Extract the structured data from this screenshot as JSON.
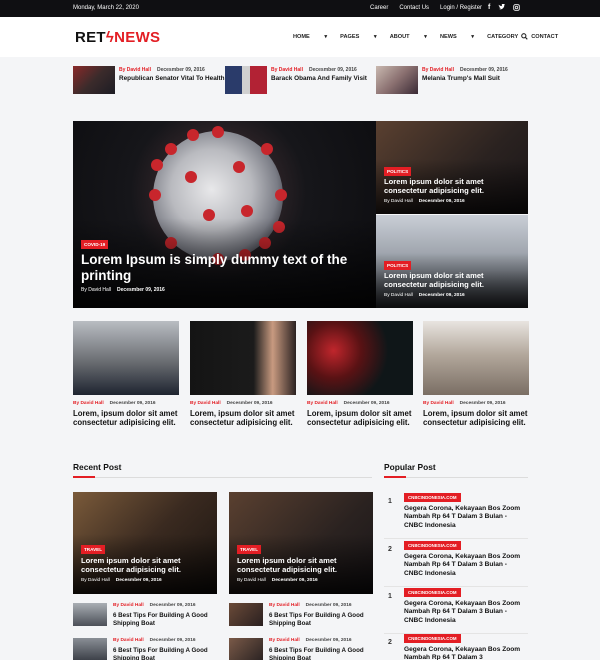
{
  "topbar": {
    "date": "Monday, March 22, 2020",
    "links": [
      "Career",
      "Contact Us",
      "Login / Register"
    ],
    "social_icons": [
      "facebook-icon",
      "twitter-icon",
      "instagram-icon"
    ]
  },
  "logo": {
    "part1": "RET",
    "part2": "NEWS"
  },
  "nav": {
    "items": [
      "HOME",
      "PAGES",
      "ABOUT",
      "NEWS",
      "CATEGORY",
      "CONTACT"
    ],
    "search_icon": "search-icon"
  },
  "ticker": [
    {
      "author": "By David Hall",
      "date": "Decesmber 09, 2016",
      "title": "Republican Senator Vital To Health"
    },
    {
      "author": "By David Hall",
      "date": "Decesmber 09, 2016",
      "title": "Barack Obama And Family Visit"
    },
    {
      "author": "By David Hall",
      "date": "Decesmber 09, 2016",
      "title": "Melania Trump's Mall Suit"
    }
  ],
  "hero": {
    "badge": "COVID-19",
    "title": "Lorem Ipsum is simply dummy text of the printing",
    "author": "By David Hall",
    "date": "Decesmber 09, 2016"
  },
  "side_stories": [
    {
      "badge": "POLITICS",
      "title": "Lorem ipsum dolor sit amet consectetur adipisicing elit.",
      "author": "By David Hall",
      "date": "Decesmber 09, 2016"
    },
    {
      "badge": "POLITICS",
      "title": "Lorem ipsum dolor sit amet consectetur adipisicing elit.",
      "author": "By David Hall",
      "date": "Decesmber 09, 2016"
    }
  ],
  "cards": [
    {
      "author": "By David Hall",
      "date": "Decesmber 09, 2016",
      "title": "Lorem, ipsum dolor sit amet consectetur adipisicing elit."
    },
    {
      "author": "By David Hall",
      "date": "Decesmber 09, 2016",
      "title": "Lorem, ipsum dolor sit amet consectetur adipisicing elit."
    },
    {
      "author": "By David Hall",
      "date": "Decesmber 09, 2016",
      "title": "Lorem, ipsum dolor sit amet consectetur adipisicing elit."
    },
    {
      "author": "By David Hall",
      "date": "Decesmber 09, 2016",
      "title": "Lorem, ipsum dolor sit amet consectetur adipisicing elit."
    }
  ],
  "recent": {
    "heading": "Recent Post",
    "features": [
      {
        "badge": "TRAVEL",
        "title": "Lorem ipsum dolor sit amet consectetur adipisicing elit.",
        "author": "By David Hall",
        "date": "Decesmber 09, 2016"
      },
      {
        "badge": "TRAVEL",
        "title": "Lorem ipsum dolor sit amet consectetur adipisicing elit.",
        "author": "By David Hall",
        "date": "Decesmber 09, 2016"
      }
    ],
    "small": [
      {
        "author": "By David Hall",
        "date": "Decesmber 09, 2016",
        "title": "6 Best Tips For Building A Good Shipping Boat"
      },
      {
        "author": "By David Hall",
        "date": "Decesmber 09, 2016",
        "title": "6 Best Tips For Building A Good Shipping Boat"
      },
      {
        "author": "By David Hall",
        "date": "Decesmber 09, 2016",
        "title": "6 Best Tips For Building A Good Shipping Boat"
      },
      {
        "author": "By David Hall",
        "date": "Decesmber 09, 2016",
        "title": "6 Best Tips For Building A Good Shipping Boat"
      }
    ]
  },
  "popular": {
    "heading": "Popular Post",
    "items": [
      {
        "num": "1",
        "source": "CNBCINDONESIA.COM",
        "title": "Gegera Corona, Kekayaan Bos Zoom Nambah Rp 64 T Dalam 3 Bulan - CNBC Indonesia"
      },
      {
        "num": "2",
        "source": "CNBCINDONESIA.COM",
        "title": "Gegera Corona, Kekayaan Bos Zoom Nambah Rp 64 T Dalam 3 Bulan - CNBC Indonesia"
      },
      {
        "num": "1",
        "source": "CNBCINDONESIA.COM",
        "title": "Gegera Corona, Kekayaan Bos Zoom Nambah Rp 64 T Dalam 3 Bulan - CNBC Indonesia"
      },
      {
        "num": "2",
        "source": "CNBCINDONESIA.COM",
        "title": "Gegera Corona, Kekayaan Bos Zoom Nambah Rp 64 T Dalam 3"
      }
    ]
  },
  "colors": {
    "accent": "#e31e24",
    "topbar": "#0f0f12"
  }
}
